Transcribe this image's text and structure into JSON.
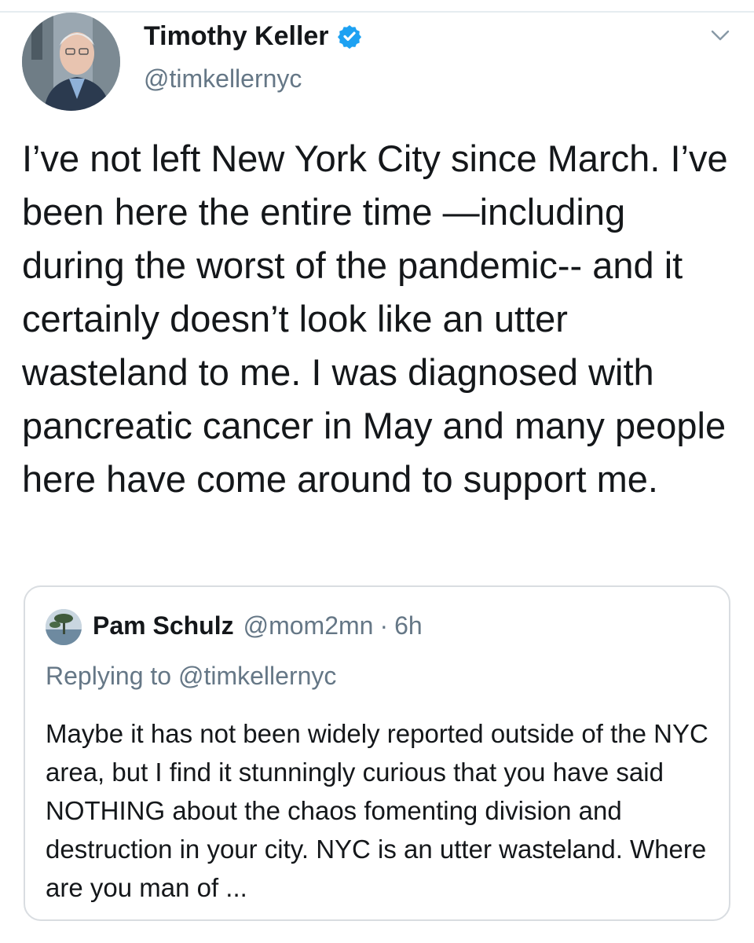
{
  "tweet": {
    "author_name": "Timothy Keller",
    "author_handle": "@timkellernyc",
    "icons": {
      "verified": "verified-badge-icon",
      "menu": "chevron-down-icon"
    },
    "text": "I’ve not left New York City since March. I’ve been here the entire time —including during the worst of the pandemic-- and it certainly doesn’t look like an utter wasteland to me. I was diagnosed with pancreatic cancer in May and many people here have come around to support me."
  },
  "quoted_tweet": {
    "author_name": "Pam Schulz",
    "author_handle": "@mom2mn",
    "separator": "·",
    "time": "6h",
    "replying_label": "Replying to",
    "replying_handle": "@timkellernyc",
    "text": "Maybe it has not been widely reported outside of the NYC area, but I find it stunningly curious that you have said NOTHING about the chaos fomenting division and destruction in your city. NYC is an utter wasteland. Where are you man of ..."
  },
  "colors": {
    "text_primary": "#14171a",
    "text_secondary": "#657786",
    "verified_blue": "#1da1f2",
    "border": "#d9dde1"
  }
}
